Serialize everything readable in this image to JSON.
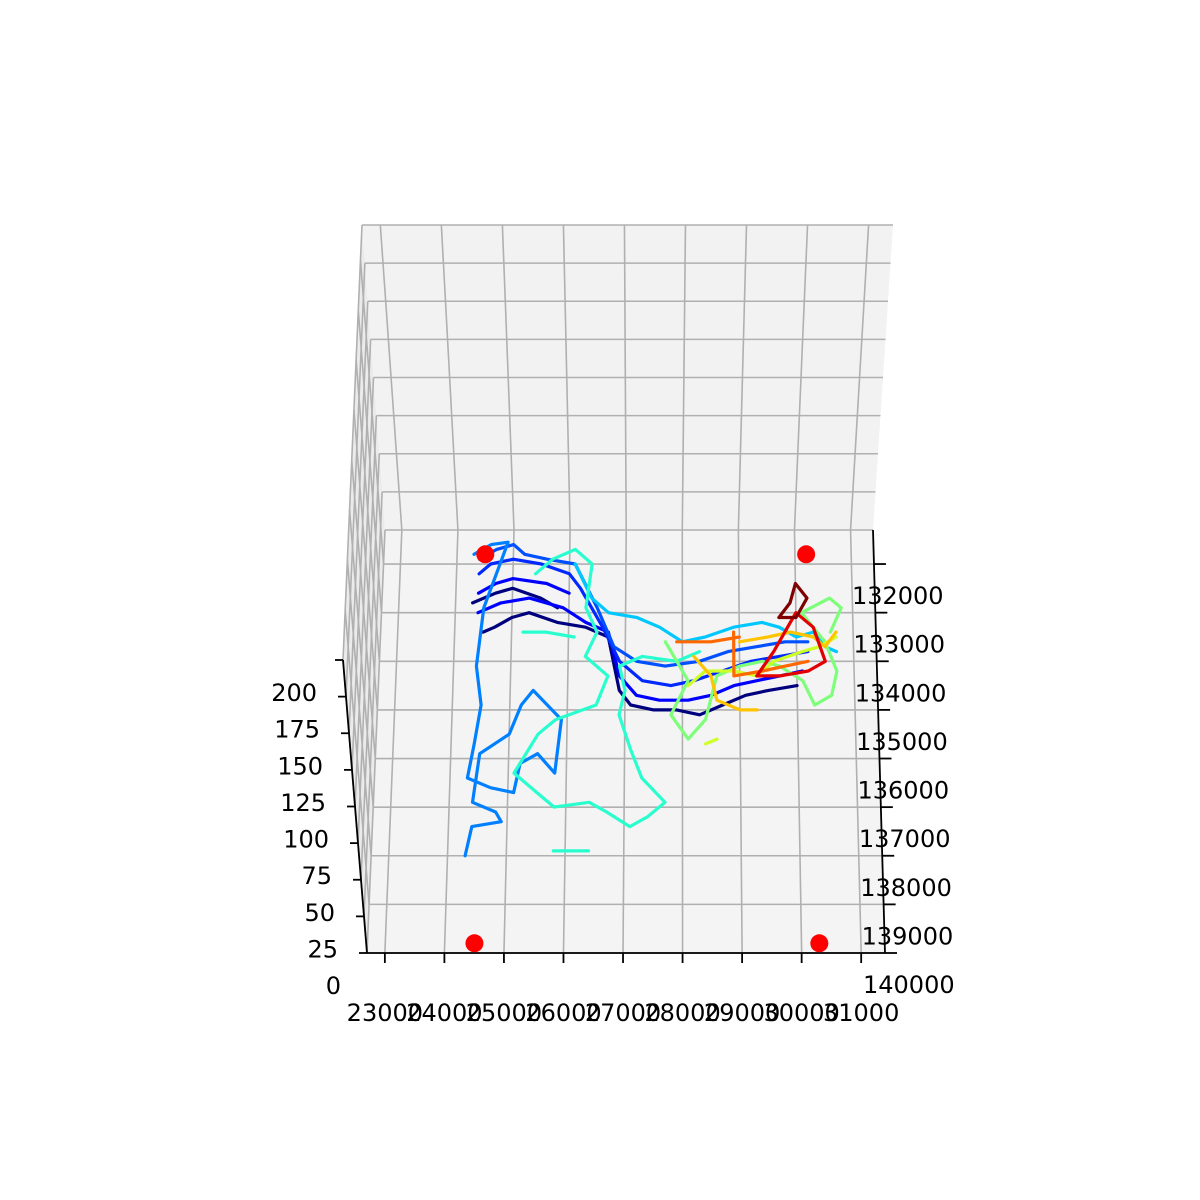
{
  "chart_data": {
    "type": "line",
    "projection": "3d",
    "title": "",
    "xlabel": "",
    "ylabel": "",
    "zlabel": "",
    "grid": true,
    "x_ticks": [
      "23000",
      "24000",
      "25000",
      "26000",
      "27000",
      "28000",
      "29000",
      "30000",
      "31000"
    ],
    "y_ticks": [
      "132000",
      "133000",
      "134000",
      "135000",
      "136000",
      "137000",
      "138000",
      "139000",
      "140000"
    ],
    "z_ticks": [
      "0",
      "25",
      "50",
      "75",
      "100",
      "125",
      "150",
      "175",
      "200"
    ],
    "xlim": [
      22700,
      31400
    ],
    "ylim": [
      131300,
      140000
    ],
    "colormap": [
      "#00007f",
      "#0000ff",
      "#0080ff",
      "#00c8ff",
      "#29ffce",
      "#7dff7a",
      "#ceff29",
      "#ffc400",
      "#ff6800",
      "#e30000",
      "#7f0000"
    ],
    "markers": {
      "color": "#ff0000",
      "points": [
        {
          "x": 24500,
          "y": 131800
        },
        {
          "x": 30200,
          "y": 131800
        },
        {
          "x": 24500,
          "y": 139800
        },
        {
          "x": 30300,
          "y": 139800
        }
      ]
    },
    "series": [
      {
        "color": "#00007f",
        "points": [
          [
            24500,
            133400
          ],
          [
            24700,
            133300
          ],
          [
            25000,
            133100
          ],
          [
            25300,
            133000
          ],
          [
            25800,
            133200
          ],
          [
            26300,
            133300
          ],
          [
            26700,
            133500
          ],
          [
            26900,
            134600
          ],
          [
            27100,
            134900
          ],
          [
            27500,
            135000
          ],
          [
            27900,
            135000
          ],
          [
            28300,
            135100
          ],
          [
            28700,
            134900
          ],
          [
            29100,
            134700
          ],
          [
            29500,
            134600
          ],
          [
            30000,
            134500
          ]
        ]
      },
      {
        "color": "#00007f",
        "points": [
          [
            24300,
            132800
          ],
          [
            24700,
            132600
          ],
          [
            25000,
            132500
          ],
          [
            25500,
            132700
          ],
          [
            25800,
            132900
          ]
        ]
      },
      {
        "color": "#0000ff",
        "points": [
          [
            24400,
            133000
          ],
          [
            24800,
            132800
          ],
          [
            25300,
            132700
          ],
          [
            25900,
            132900
          ],
          [
            26300,
            133200
          ],
          [
            26700,
            133400
          ],
          [
            26900,
            134300
          ],
          [
            27200,
            134700
          ],
          [
            27600,
            134800
          ],
          [
            28100,
            134800
          ],
          [
            28500,
            134700
          ],
          [
            28900,
            134500
          ],
          [
            29300,
            134400
          ],
          [
            29700,
            134300
          ],
          [
            30100,
            134200
          ]
        ]
      },
      {
        "color": "#0000ff",
        "points": [
          [
            24400,
            132600
          ],
          [
            24700,
            132400
          ],
          [
            25000,
            132300
          ],
          [
            25600,
            132400
          ],
          [
            26000,
            132600
          ]
        ]
      },
      {
        "color": "#0028ff",
        "points": [
          [
            24400,
            132200
          ],
          [
            24600,
            132000
          ],
          [
            25000,
            131900
          ],
          [
            25500,
            132000
          ],
          [
            26000,
            132200
          ],
          [
            26200,
            132500
          ],
          [
            26600,
            133300
          ],
          [
            26900,
            134000
          ],
          [
            27300,
            134400
          ],
          [
            27800,
            134500
          ],
          [
            28200,
            134400
          ],
          [
            28700,
            134200
          ],
          [
            29200,
            134000
          ],
          [
            29700,
            133900
          ],
          [
            30200,
            133800
          ]
        ]
      },
      {
        "color": "#0050ff",
        "points": [
          [
            24400,
            131900
          ],
          [
            24700,
            131700
          ],
          [
            25000,
            131600
          ],
          [
            25200,
            131800
          ],
          [
            25600,
            131900
          ],
          [
            26100,
            132000
          ],
          [
            26500,
            132900
          ],
          [
            26800,
            133700
          ],
          [
            27200,
            134000
          ],
          [
            27700,
            134100
          ],
          [
            28300,
            134000
          ],
          [
            28800,
            133800
          ],
          [
            29300,
            133700
          ],
          [
            29800,
            133600
          ],
          [
            30200,
            133600
          ]
        ]
      },
      {
        "color": "#0080ff",
        "points": [
          [
            24300,
            131800
          ],
          [
            24600,
            131600
          ],
          [
            24900,
            131550
          ],
          [
            24500,
            132900
          ],
          [
            24400,
            134100
          ],
          [
            24500,
            134900
          ],
          [
            24400,
            135700
          ],
          [
            24300,
            136400
          ],
          [
            24700,
            136600
          ],
          [
            25100,
            136700
          ],
          [
            25200,
            136100
          ],
          [
            25500,
            135900
          ],
          [
            25800,
            136300
          ],
          [
            25900,
            135200
          ],
          [
            25400,
            134600
          ],
          [
            25200,
            134900
          ],
          [
            25000,
            135500
          ],
          [
            24500,
            135900
          ],
          [
            24400,
            136900
          ],
          [
            24800,
            137100
          ],
          [
            24900,
            137300
          ],
          [
            24400,
            137400
          ],
          [
            24300,
            138000
          ]
        ]
      },
      {
        "color": "#00c8ff",
        "points": [
          [
            26100,
            132000
          ],
          [
            26400,
            132700
          ],
          [
            26700,
            133000
          ],
          [
            27200,
            133100
          ],
          [
            27600,
            133300
          ],
          [
            28000,
            133600
          ],
          [
            28400,
            133500
          ],
          [
            28900,
            133300
          ],
          [
            29400,
            133200
          ],
          [
            29700,
            133300
          ],
          [
            30000,
            133500
          ],
          [
            30300,
            133400
          ],
          [
            30500,
            133700
          ],
          [
            30700,
            133800
          ]
        ]
      },
      {
        "color": "#29ffce",
        "points": [
          [
            25400,
            132200
          ],
          [
            25700,
            131900
          ],
          [
            26100,
            131700
          ],
          [
            26400,
            132000
          ],
          [
            26300,
            132900
          ],
          [
            26500,
            133400
          ],
          [
            26300,
            133900
          ],
          [
            26700,
            134300
          ],
          [
            26500,
            134900
          ],
          [
            25800,
            135200
          ],
          [
            25500,
            135500
          ],
          [
            25100,
            136300
          ],
          [
            25500,
            136700
          ],
          [
            25800,
            137000
          ],
          [
            26400,
            136900
          ],
          [
            26700,
            137100
          ],
          [
            27100,
            137400
          ],
          [
            27400,
            137200
          ],
          [
            27700,
            136900
          ],
          [
            27300,
            136400
          ],
          [
            27100,
            135800
          ],
          [
            26900,
            135100
          ],
          [
            27000,
            134600
          ],
          [
            26900,
            134100
          ],
          [
            27300,
            133900
          ],
          [
            27900,
            134000
          ],
          [
            28300,
            133800
          ]
        ]
      },
      {
        "color": "#29ffce",
        "points": [
          [
            25200,
            133400
          ],
          [
            25600,
            133400
          ],
          [
            26100,
            133500
          ]
        ]
      },
      {
        "color": "#29ffce",
        "points": [
          [
            25800,
            137900
          ],
          [
            26400,
            137900
          ]
        ]
      },
      {
        "color": "#7dff7a",
        "points": [
          [
            27700,
            133600
          ],
          [
            28100,
            134400
          ],
          [
            27800,
            135100
          ],
          [
            28100,
            135600
          ],
          [
            28400,
            135200
          ],
          [
            28600,
            134300
          ],
          [
            29000,
            134100
          ],
          [
            29400,
            134000
          ],
          [
            29700,
            134100
          ],
          [
            30100,
            134400
          ],
          [
            30300,
            134900
          ],
          [
            30600,
            134700
          ],
          [
            30700,
            134200
          ],
          [
            30500,
            133600
          ],
          [
            30100,
            133000
          ],
          [
            30600,
            132700
          ],
          [
            30800,
            132900
          ],
          [
            30600,
            133400
          ]
        ]
      },
      {
        "color": "#ceff29",
        "points": [
          [
            28100,
            134500
          ],
          [
            28400,
            134200
          ],
          [
            28900,
            134200
          ],
          [
            29300,
            134300
          ],
          [
            29600,
            134000
          ],
          [
            30100,
            133800
          ],
          [
            30400,
            133700
          ],
          [
            30700,
            133500
          ]
        ]
      },
      {
        "color": "#ceff29",
        "points": [
          [
            28400,
            135700
          ],
          [
            28600,
            135600
          ]
        ]
      },
      {
        "color": "#ffc400",
        "points": [
          [
            28200,
            133900
          ],
          [
            28500,
            134300
          ],
          [
            28600,
            134800
          ],
          [
            29000,
            135000
          ],
          [
            29300,
            135000
          ]
        ]
      },
      {
        "color": "#ffc400",
        "points": [
          [
            29000,
            133600
          ],
          [
            29500,
            133500
          ],
          [
            29900,
            133400
          ],
          [
            30300,
            133500
          ],
          [
            30500,
            133700
          ],
          [
            30700,
            133400
          ]
        ]
      },
      {
        "color": "#ff6800",
        "points": [
          [
            27900,
            133600
          ],
          [
            28500,
            133600
          ],
          [
            29000,
            133500
          ]
        ]
      },
      {
        "color": "#ff6800",
        "points": [
          [
            28900,
            133400
          ],
          [
            28900,
            134300
          ],
          [
            29400,
            134200
          ],
          [
            29800,
            134100
          ],
          [
            30200,
            134000
          ]
        ]
      },
      {
        "color": "#e30000",
        "points": [
          [
            29300,
            134300
          ],
          [
            29600,
            133800
          ],
          [
            29800,
            133400
          ],
          [
            30000,
            133000
          ],
          [
            30300,
            133300
          ],
          [
            30500,
            134000
          ],
          [
            30200,
            134200
          ],
          [
            29700,
            134300
          ],
          [
            29300,
            134300
          ]
        ]
      },
      {
        "color": "#7f0000",
        "points": [
          [
            29700,
            133100
          ],
          [
            29900,
            132800
          ],
          [
            30000,
            132400
          ],
          [
            30200,
            132700
          ],
          [
            30000,
            133100
          ],
          [
            29700,
            133100
          ]
        ]
      }
    ]
  }
}
